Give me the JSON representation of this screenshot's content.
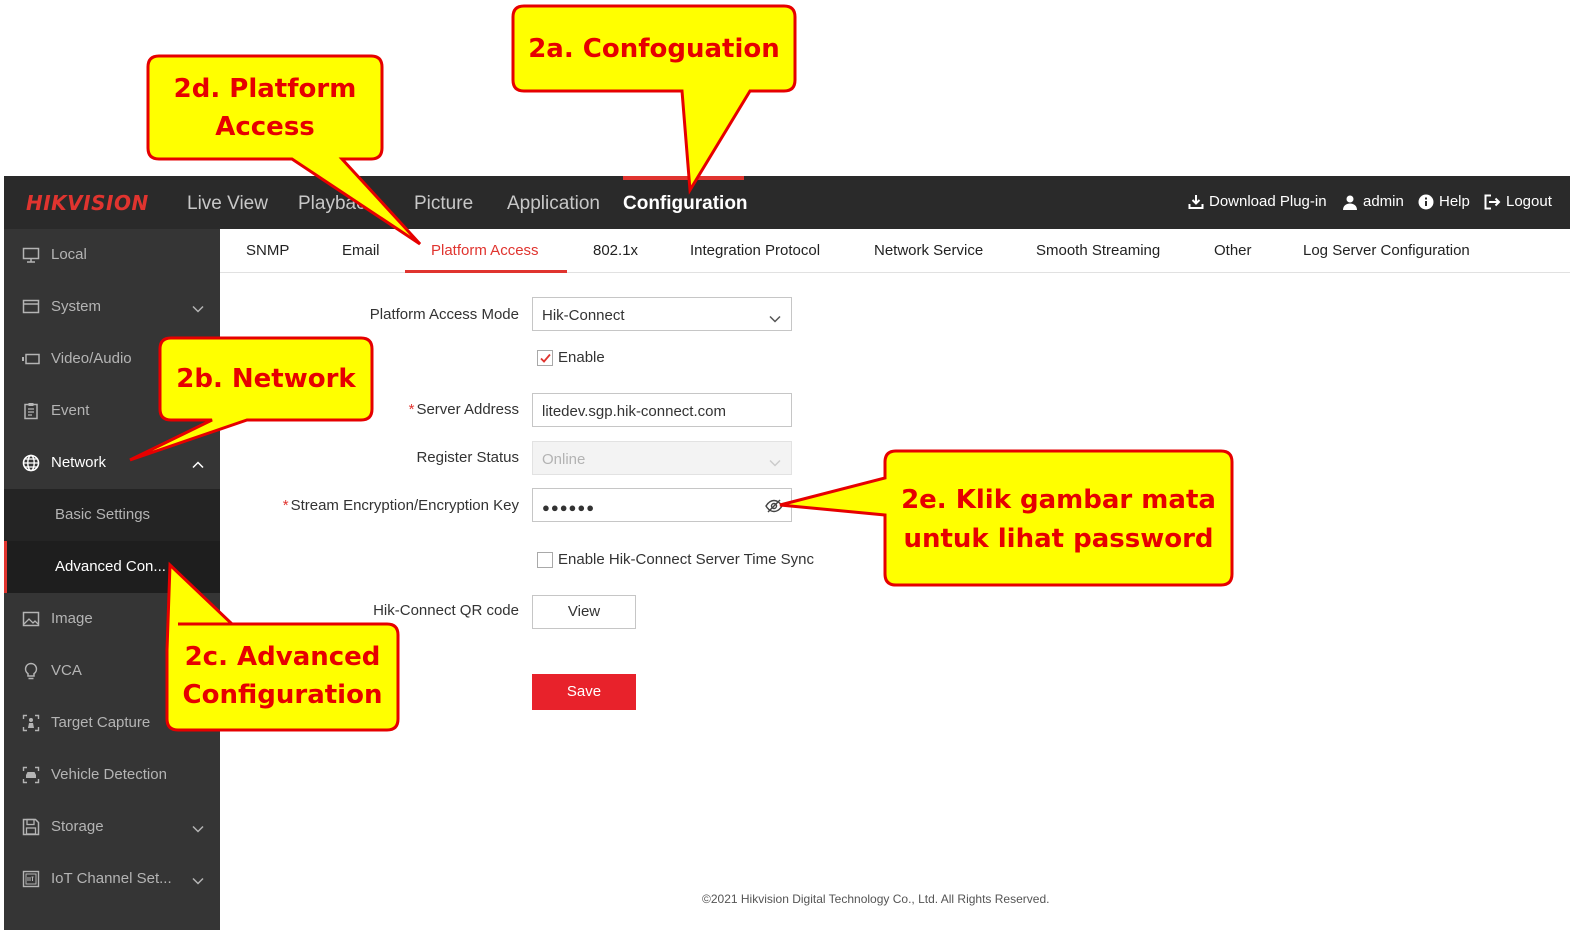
{
  "topbar": {
    "logo": "HIKVISION",
    "nav": [
      {
        "label": "Live View"
      },
      {
        "label": "Playback"
      },
      {
        "label": "Picture"
      },
      {
        "label": "Application"
      },
      {
        "label": "Configuration",
        "active": true
      }
    ],
    "download_plugin": "Download Plug-in",
    "user": "admin",
    "help": "Help",
    "logout": "Logout"
  },
  "sidebar": {
    "items": [
      {
        "label": "Local",
        "icon": "monitor-icon"
      },
      {
        "label": "System",
        "icon": "window-icon"
      },
      {
        "label": "Video/Audio",
        "icon": "camera-icon"
      },
      {
        "label": "Event",
        "icon": "clipboard-icon"
      },
      {
        "label": "Network",
        "icon": "globe-icon",
        "expanded": true
      },
      {
        "label": "Image",
        "icon": "image-icon"
      },
      {
        "label": "VCA",
        "icon": "bulb-icon"
      },
      {
        "label": "Target Capture",
        "icon": "person-capture-icon"
      },
      {
        "label": "Vehicle Detection",
        "icon": "vehicle-icon"
      },
      {
        "label": "Storage",
        "icon": "floppy-icon"
      },
      {
        "label": "IoT Channel Set...",
        "icon": "iot-icon"
      }
    ],
    "network_sub": [
      {
        "label": "Basic Settings"
      },
      {
        "label": "Advanced Con...",
        "active": true
      }
    ]
  },
  "tabs": [
    {
      "label": "SNMP"
    },
    {
      "label": "Email"
    },
    {
      "label": "Platform Access",
      "active": true
    },
    {
      "label": "802.1x"
    },
    {
      "label": "Integration Protocol"
    },
    {
      "label": "Network Service"
    },
    {
      "label": "Smooth Streaming"
    },
    {
      "label": "Other"
    },
    {
      "label": "Log Server Configuration"
    }
  ],
  "form": {
    "mode_label": "Platform Access Mode",
    "mode_value": "Hik-Connect",
    "enable_label": "Enable",
    "enable_checked": true,
    "server_label": "Server Address",
    "server_value": "litedev.sgp.hik-connect.com",
    "status_label": "Register Status",
    "status_value": "Online",
    "key_label": "Stream Encryption/Encryption Key",
    "key_value": "●●●●●●",
    "time_sync_label": "Enable Hik-Connect Server Time Sync",
    "time_sync_checked": false,
    "qr_label": "Hik-Connect QR code",
    "view_button": "View",
    "save_button": "Save"
  },
  "footer": "©2021 Hikvision Digital Technology Co., Ltd. All Rights Reserved.",
  "callouts": {
    "a": "2a. Confoguation",
    "b": "2b. Network",
    "c_line1": "2c. Advanced",
    "c_line2": "Configuration",
    "d_line1": "2d. Platform",
    "d_line2": "Access",
    "e_line1": "2e. Klik gambar mata",
    "e_line2": "untuk lihat password"
  },
  "colors": {
    "accent": "#e0342f",
    "topbar": "#2a2a2a",
    "sidebar": "#353535",
    "callout_fill": "#ffff00",
    "callout_border": "#e60000"
  }
}
